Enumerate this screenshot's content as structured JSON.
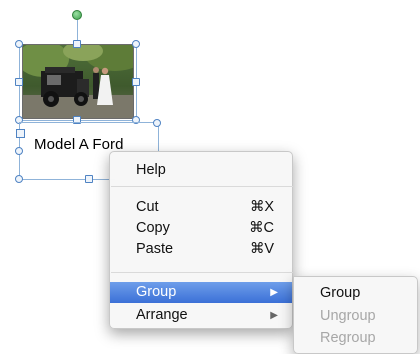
{
  "object": {
    "caption": "Model A Ford"
  },
  "context_menu": {
    "help": "Help",
    "cut": {
      "label": "Cut",
      "shortcut": "⌘X"
    },
    "copy": {
      "label": "Copy",
      "shortcut": "⌘C"
    },
    "paste": {
      "label": "Paste",
      "shortcut": "⌘V"
    },
    "group": {
      "label": "Group",
      "arrow": "▶"
    },
    "arrange": {
      "label": "Arrange",
      "arrow": "▶"
    }
  },
  "submenu": {
    "group": "Group",
    "ungroup": "Ungroup",
    "regroup": "Regroup"
  },
  "colors": {
    "highlight": "#3b70d7",
    "selection": "#4f83c3",
    "rotate_handle": "#3ea14c"
  }
}
